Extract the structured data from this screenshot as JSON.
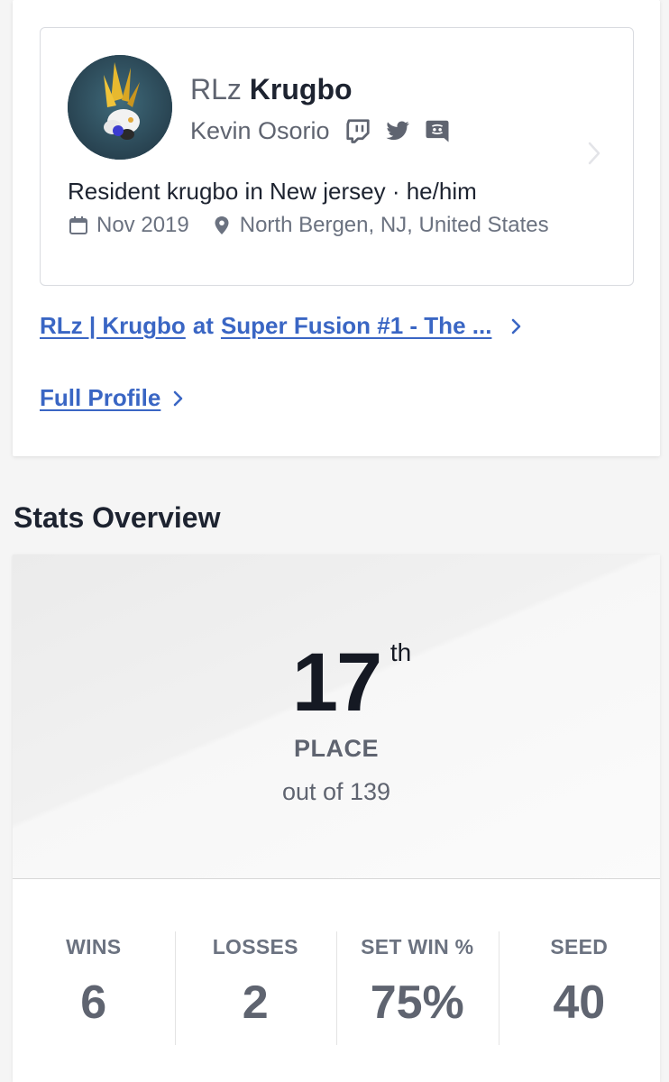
{
  "profile": {
    "prefix": "RLz",
    "gamertag": "Krugbo",
    "real_name": "Kevin Osorio",
    "social_icons": [
      "twitch-icon",
      "twitter-icon",
      "discord-icon"
    ],
    "bio": "Resident krugbo in New jersey · he/him",
    "joined": "Nov 2019",
    "location": "North Bergen, NJ, United States"
  },
  "links": {
    "event_player": "RLz | Krugbo",
    "event_mid": "at",
    "event_name": "Super Fusion #1 - The ...",
    "full_profile": "Full Profile"
  },
  "stats": {
    "heading": "Stats Overview",
    "placement": "17",
    "placement_suffix": "th",
    "placement_label": "PLACE",
    "out_of": "out of 139",
    "items": [
      {
        "label": "WINS",
        "value": "6"
      },
      {
        "label": "LOSSES",
        "value": "2"
      },
      {
        "label": "SET WIN %",
        "value": "75%"
      },
      {
        "label": "SEED",
        "value": "40"
      }
    ]
  },
  "colors": {
    "link": "#3a66c4",
    "text_dark": "#1d2330",
    "text_muted": "#5f6470"
  }
}
